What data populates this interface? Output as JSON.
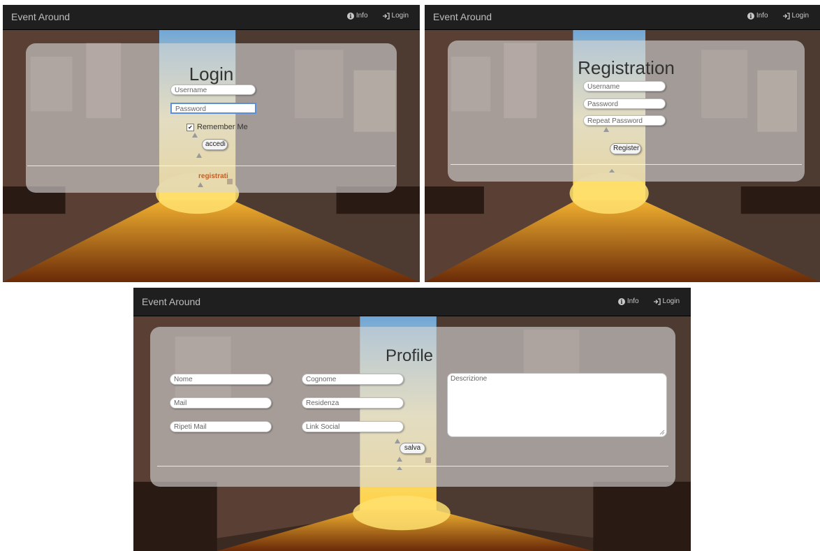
{
  "app": {
    "brand": "Event Around",
    "nav_info": "Info",
    "nav_login": "Login"
  },
  "login": {
    "title": "Login",
    "username_placeholder": "Username",
    "password_placeholder": "Password",
    "remember_label": "Remember Me",
    "remember_checked": true,
    "submit_label": "accedi",
    "register_link": "registrati"
  },
  "registration": {
    "title": "Registration",
    "username_placeholder": "Username",
    "password_placeholder": "Password",
    "repeat_password_placeholder": "Repeat Password",
    "submit_label": "Register"
  },
  "profile": {
    "title": "Profile",
    "nome_placeholder": "Nome",
    "cognome_placeholder": "Cognome",
    "descrizione_placeholder": "Descrizione",
    "mail_placeholder": "Mail",
    "residenza_placeholder": "Residenza",
    "ripeti_mail_placeholder": "Ripeti Mail",
    "link_social_placeholder": "Link Social",
    "save_label": "salva"
  },
  "colors": {
    "navbar": "#1f1f1f",
    "panel": "#d7d7d7",
    "link": "#c0602a",
    "focus": "#5b8fd8"
  }
}
